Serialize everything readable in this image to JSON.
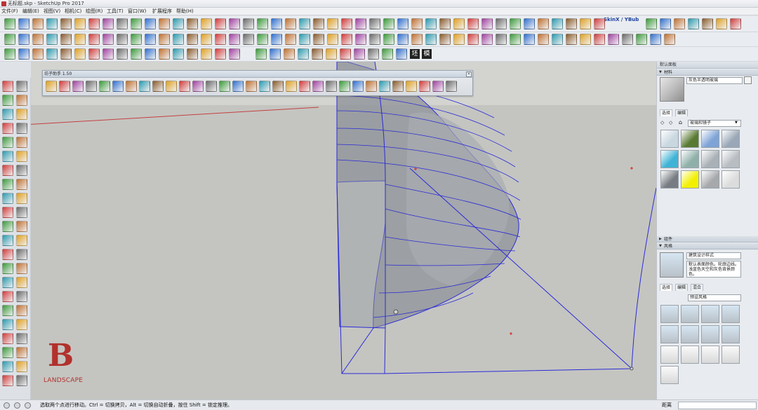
{
  "window": {
    "title": "无标题.skp - SketchUp Pro 2017"
  },
  "menu": [
    "文件(F)",
    "编辑(E)",
    "视图(V)",
    "相机(C)",
    "绘图(R)",
    "工具(T)",
    "窗口(W)",
    "扩展程序",
    "帮助(H)"
  ],
  "toolbar": {
    "skinx_label": "SkinX / YBub",
    "hat_label": "坯",
    "model_label": "模"
  },
  "float_panel": {
    "title": "坊子助手 1.50"
  },
  "viewport": {
    "background": "#c4c5c1",
    "edge_color": "#2b2bd6",
    "sky_line_color": "#c44040"
  },
  "right_panel": {
    "title": "默认面板",
    "materials": {
      "header": "材料",
      "material_name": "灰色半透明玻璃",
      "tabs": [
        "选择",
        "编辑"
      ],
      "category": "玻璃和镜子",
      "swatch_colors": [
        "#c9d7e0",
        "#5a7a32",
        "#7ea3d6",
        "#9aa7b6",
        "#3fb3d6",
        "#8fb0a8",
        "#a9b0b6",
        "#b8bdc2",
        "#777c82",
        "#f2f000",
        "#a6a8ab",
        "#dcdcdc"
      ]
    },
    "components_header": "组件",
    "styles": {
      "header": "风格",
      "style_name": "建筑设计样式",
      "description": "默认表面颜色。轮廓边线。浅蓝色天空和灰色背景颜色。",
      "tabs": [
        "选择",
        "编辑",
        "混合"
      ],
      "category": "预设风格"
    }
  },
  "status": {
    "message": "选取两个点进行移动。Ctrl = 切换拷贝，Alt = 切换自动折叠，按住 Shift = 锁定推理。",
    "measure_label": "距离"
  },
  "watermark": {
    "letter": "B",
    "text": "LANDSCAPE"
  }
}
